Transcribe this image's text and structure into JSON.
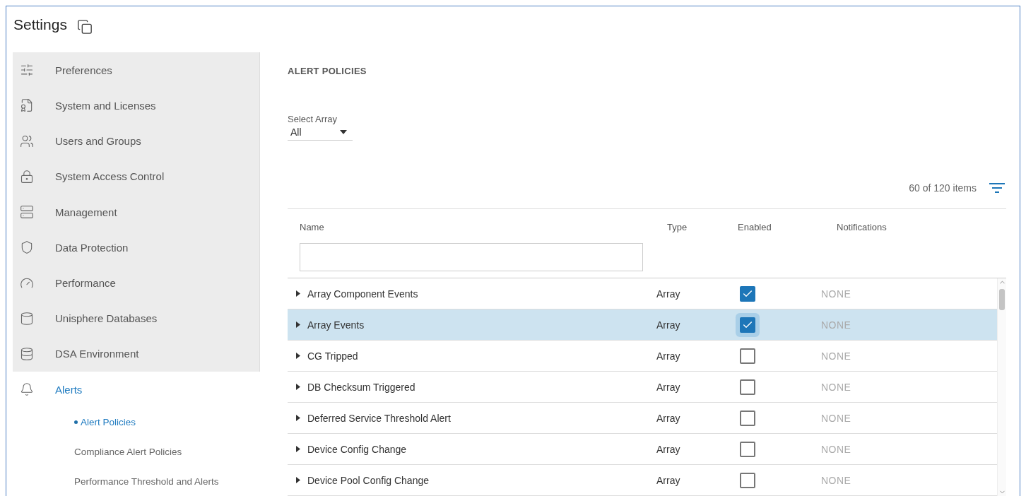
{
  "window": {
    "title": "Settings"
  },
  "sidebar": {
    "items": [
      {
        "label": "Preferences",
        "selected": false
      },
      {
        "label": "System and Licenses",
        "selected": false
      },
      {
        "label": "Users and Groups",
        "selected": false
      },
      {
        "label": "System Access Control",
        "selected": false
      },
      {
        "label": "Management",
        "selected": false
      },
      {
        "label": "Data Protection",
        "selected": false
      },
      {
        "label": "Performance",
        "selected": false
      },
      {
        "label": "Unisphere Databases",
        "selected": false
      },
      {
        "label": "DSA Environment",
        "selected": false
      },
      {
        "label": "Alerts",
        "selected": true,
        "children": [
          {
            "label": "Alert Policies",
            "selected": true
          },
          {
            "label": "Compliance Alert Policies",
            "selected": false
          },
          {
            "label": "Performance Threshold and Alerts",
            "selected": false
          }
        ]
      }
    ]
  },
  "page": {
    "heading": "ALERT POLICIES",
    "select": {
      "label": "Select Array",
      "value": "All"
    },
    "count": "60 of 120 items"
  },
  "table": {
    "columns": [
      "Name",
      "Type",
      "Enabled",
      "Notifications"
    ],
    "rows": [
      {
        "name": "Array Component Events",
        "type": "Array",
        "enabled": true,
        "notifications": "NONE",
        "selected": false
      },
      {
        "name": "Array Events",
        "type": "Array",
        "enabled": true,
        "notifications": "NONE",
        "selected": true
      },
      {
        "name": "CG Tripped",
        "type": "Array",
        "enabled": false,
        "notifications": "NONE",
        "selected": false
      },
      {
        "name": "DB Checksum Triggered",
        "type": "Array",
        "enabled": false,
        "notifications": "NONE",
        "selected": false
      },
      {
        "name": "Deferred Service Threshold Alert",
        "type": "Array",
        "enabled": false,
        "notifications": "NONE",
        "selected": false
      },
      {
        "name": "Device Config Change",
        "type": "Array",
        "enabled": false,
        "notifications": "NONE",
        "selected": false
      },
      {
        "name": "Device Pool Config Change",
        "type": "Array",
        "enabled": false,
        "notifications": "NONE",
        "selected": false
      }
    ]
  }
}
